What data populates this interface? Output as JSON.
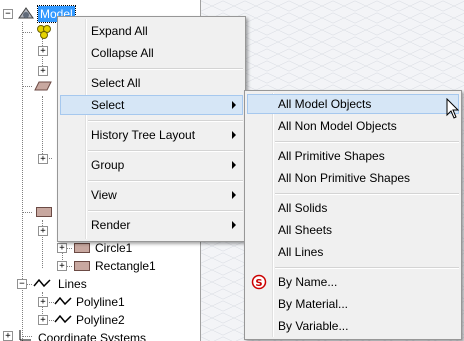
{
  "tree": {
    "root_label": "Model",
    "circle_label": "Circle1",
    "rectangle_label": "Rectangle1",
    "lines_label": "Lines",
    "polyline1_label": "Polyline1",
    "polyline2_label": "Polyline2",
    "coord_label": "Coordinate Systems",
    "expand_glyph": "+",
    "collapse_glyph": "−"
  },
  "context_menu": {
    "expand_all": "Expand All",
    "collapse_all": "Collapse All",
    "select_all": "Select All",
    "select": "Select",
    "history_tree_layout": "History Tree Layout",
    "group": "Group",
    "view": "View",
    "render": "Render"
  },
  "submenu": {
    "all_model_objects": "All Model Objects",
    "all_non_model_objects": "All Non Model Objects",
    "all_primitive_shapes": "All Primitive Shapes",
    "all_non_primitive_shapes": "All Non Primitive Shapes",
    "all_solids": "All Solids",
    "all_sheets": "All Sheets",
    "all_lines": "All Lines",
    "by_name": "By Name...",
    "by_material": "By Material...",
    "by_variable": "By Variable..."
  },
  "icons": {
    "model": "model-icon",
    "group": "group-icon",
    "sheet": "sheet-icon",
    "rectangle": "rectangle-icon",
    "polyline": "polyline-icon",
    "coordinate": "coordinate-system-icon",
    "by_name": "select-by-name-icon",
    "cursor": "mouse-cursor-icon"
  },
  "colors": {
    "selection": "#3399ff",
    "menu_hot": "#d6e6f6",
    "by_name_icon": "#cc0000"
  }
}
